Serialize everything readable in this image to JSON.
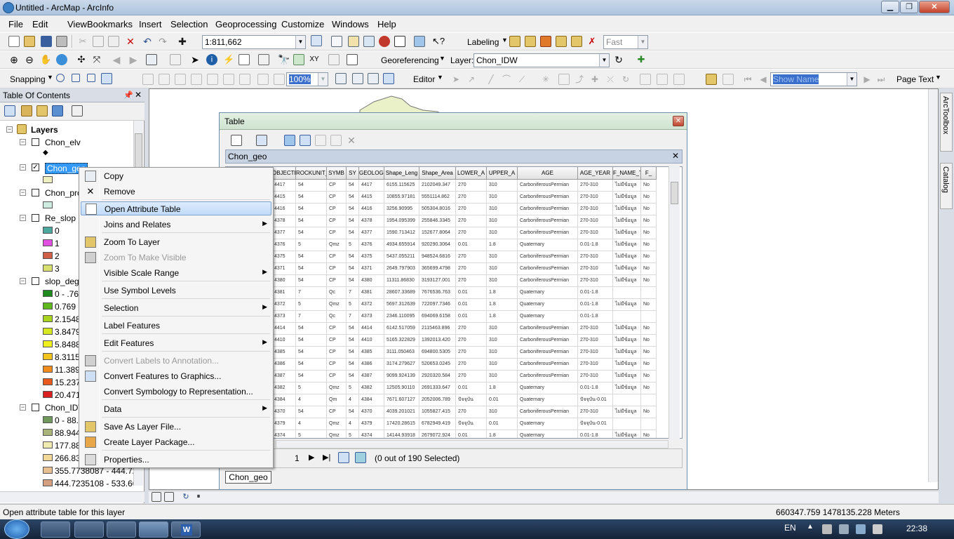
{
  "window": {
    "title": "Untitled - ArcMap - ArcInfo"
  },
  "menu": [
    "File",
    "Edit",
    "View",
    "Bookmarks",
    "Insert",
    "Selection",
    "Geoprocessing",
    "Customize",
    "Windows",
    "Help"
  ],
  "toolbar": {
    "scale": "1:811,662",
    "labeling": "Labeling",
    "fast": "Fast",
    "georeferencing": "Georeferencing",
    "layer_label": "Layer:",
    "layer_value": "Chon_IDW",
    "snapping": "Snapping",
    "zoom_pct": "100%",
    "editor": "Editor",
    "show_name": "Show Name",
    "page_text": "Page Text"
  },
  "toc": {
    "title": "Table Of Contents",
    "layers_root": "Layers",
    "items": [
      {
        "name": "Chon_elv"
      },
      {
        "name": "Chon_geo"
      },
      {
        "name": "Chon_pro"
      },
      {
        "name": "Re_slop"
      },
      {
        "name": "slop_deg"
      },
      {
        "name": "Chon_IDW"
      }
    ],
    "re_slop_classes": [
      "0",
      "1",
      "2",
      "3"
    ],
    "slop_classes": [
      "0 - .76",
      "0.769",
      "2.1548",
      "3.8479",
      "5.8488",
      "8.3115",
      "11.389",
      "15.237",
      "20.471"
    ],
    "idw_classes": [
      "0 - 88.9",
      "88.944",
      "177.88",
      "266.83",
      "355.7738087 - 444.72",
      "444.7235108 - 533.66"
    ]
  },
  "colors": {
    "re_slop": [
      "#4aa89c",
      "#e04fe0",
      "#d06048",
      "#d8e070"
    ],
    "slop": [
      "#1e8a1e",
      "#5fb81e",
      "#a8d41e",
      "#d8e81e",
      "#f0f01e",
      "#f4c41e",
      "#f08c1e",
      "#e85a1e",
      "#d8201e"
    ],
    "idw": [
      "#6f9a5c",
      "#a8b478",
      "#f0ecb0",
      "#f2d898",
      "#e8c090",
      "#d4a080"
    ]
  },
  "context_menu": [
    {
      "label": "Copy",
      "icon": "copy-icon"
    },
    {
      "label": "Remove",
      "icon": "remove-icon"
    },
    {
      "label": "Open Attribute Table",
      "icon": "table-icon",
      "highlight": true
    },
    {
      "label": "Joins and Relates",
      "submenu": true
    },
    {
      "label": "Zoom To Layer",
      "icon": "zoom-layer-icon"
    },
    {
      "label": "Zoom To Make Visible",
      "disabled": true,
      "icon": "zoom-visible-icon"
    },
    {
      "label": "Visible Scale Range",
      "submenu": true
    },
    {
      "label": "Use Symbol Levels"
    },
    {
      "label": "Selection",
      "submenu": true
    },
    {
      "label": "Label Features"
    },
    {
      "label": "Edit Features",
      "submenu": true
    },
    {
      "label": "Convert Labels to Annotation...",
      "disabled": true,
      "icon": "annotation-icon"
    },
    {
      "label": "Convert Features to Graphics...",
      "icon": "graphics-icon"
    },
    {
      "label": "Convert Symbology to Representation..."
    },
    {
      "label": "Data",
      "submenu": true
    },
    {
      "label": "Save As Layer File...",
      "icon": "layer-file-icon"
    },
    {
      "label": "Create Layer Package...",
      "icon": "package-icon"
    },
    {
      "label": "Properties...",
      "icon": "properties-icon"
    }
  ],
  "table_window": {
    "title": "Table",
    "tab": "Chon_geo",
    "bottom_tab": "Chon_geo",
    "record": "1",
    "selection_status": "(0 out of 190 Selected)",
    "columns": [
      "",
      "OBJECTI",
      "ROCKUNIT_ID",
      "SYMB",
      "SY",
      "GEOLOGY_",
      "Shape_Leng",
      "Shape_Area",
      "LOWER_A",
      "UPPER_A",
      "AGE",
      "AGE_YEAR",
      "F_NAME_T",
      "F_"
    ],
    "rows": [
      [
        "",
        "4417",
        "54",
        "CP",
        "54",
        "4417",
        "6155.115625",
        "2102049.347",
        "270",
        "310",
        "CarboniferousPermian",
        "270-310",
        "ไม่มีข้อมูล",
        "No"
      ],
      [
        "",
        "4415",
        "54",
        "CP",
        "54",
        "4415",
        "10855.97181",
        "5551114.862",
        "270",
        "310",
        "CarboniferousPermian",
        "270-310",
        "ไม่มีข้อมูล",
        "No"
      ],
      [
        "",
        "4416",
        "54",
        "CP",
        "54",
        "4416",
        "3256.90995",
        "505304.8016",
        "270",
        "310",
        "CarboniferousPermian",
        "270-310",
        "ไม่มีข้อมูล",
        "No"
      ],
      [
        "",
        "4378",
        "54",
        "CP",
        "54",
        "4378",
        "1954.095399",
        "255846.3345",
        "270",
        "310",
        "CarboniferousPermian",
        "270-310",
        "ไม่มีข้อมูล",
        "No"
      ],
      [
        "",
        "4377",
        "54",
        "CP",
        "54",
        "4377",
        "1590.713412",
        "152677.8064",
        "270",
        "310",
        "CarboniferousPermian",
        "270-310",
        "ไม่มีข้อมูล",
        "No"
      ],
      [
        "",
        "4376",
        "5",
        "Qmz",
        "5",
        "4376",
        "4934.655914",
        "920290.3064",
        "0.01",
        "1.8",
        "Quaternary",
        "0.01-1.8",
        "ไม่มีข้อมูล",
        "No"
      ],
      [
        "",
        "4375",
        "54",
        "CP",
        "54",
        "4375",
        "5437.055211",
        "948524.6816",
        "270",
        "310",
        "CarboniferousPermian",
        "270-310",
        "ไม่มีข้อมูล",
        "No"
      ],
      [
        "",
        "4371",
        "54",
        "CP",
        "54",
        "4371",
        "2649.797903",
        "365699.4798",
        "270",
        "310",
        "CarboniferousPermian",
        "270-310",
        "ไม่มีข้อมูล",
        "No"
      ],
      [
        "",
        "4380",
        "54",
        "CP",
        "54",
        "4380",
        "11311.86830",
        "3193127.001",
        "270",
        "310",
        "CarboniferousPermian",
        "270-310",
        "ไม่มีข้อมูล",
        "No"
      ],
      [
        "",
        "4381",
        "7",
        "Qc",
        "7",
        "4381",
        "28607.33689",
        "7676536.763",
        "0.01",
        "1.8",
        "Quaternary",
        "0.01-1.8",
        "",
        ""
      ],
      [
        "",
        "4372",
        "5",
        "Qmz",
        "5",
        "4372",
        "5697.312639",
        "722097.7346",
        "0.01",
        "1.8",
        "Quaternary",
        "0.01-1.8",
        "ไม่มีข้อมูล",
        "No"
      ],
      [
        "",
        "4373",
        "7",
        "Qc",
        "7",
        "4373",
        "2346.110095",
        "694069.6158",
        "0.01",
        "1.8",
        "Quaternary",
        "0.01-1.8",
        "",
        ""
      ],
      [
        "",
        "4414",
        "54",
        "CP",
        "54",
        "4414",
        "6142.517059",
        "2115463.896",
        "270",
        "310",
        "CarboniferousPermian",
        "270-310",
        "ไม่มีข้อมูล",
        "No"
      ],
      [
        "",
        "4410",
        "54",
        "CP",
        "54",
        "4410",
        "5165.322829",
        "1392013.420",
        "270",
        "310",
        "CarboniferousPermian",
        "270-310",
        "ไม่มีข้อมูล",
        "No"
      ],
      [
        "",
        "4385",
        "54",
        "CP",
        "54",
        "4385",
        "3111.050463",
        "694800.5305",
        "270",
        "310",
        "CarboniferousPermian",
        "270-310",
        "ไม่มีข้อมูล",
        "No"
      ],
      [
        "",
        "4386",
        "54",
        "CP",
        "54",
        "4386",
        "3174.279627",
        "520653.0245",
        "270",
        "310",
        "CarboniferousPermian",
        "270-310",
        "ไม่มีข้อมูล",
        "No"
      ],
      [
        "",
        "4387",
        "54",
        "CP",
        "54",
        "4387",
        "9099.924139",
        "2920320.584",
        "270",
        "310",
        "CarboniferousPermian",
        "270-310",
        "ไม่มีข้อมูล",
        "No"
      ],
      [
        "",
        "4382",
        "5",
        "Qmz",
        "5",
        "4382",
        "12505.90110",
        "2691333.647",
        "0.01",
        "1.8",
        "Quaternary",
        "0.01-1.8",
        "ไม่มีข้อมูล",
        "No"
      ],
      [
        "",
        "4384",
        "4",
        "Qm",
        "4",
        "4384",
        "7671.607127",
        "2052006.789",
        "ปัจจุบัน",
        "0.01",
        "Quaternary",
        "ปัจจุบัน-0.01",
        "",
        ""
      ],
      [
        "",
        "4370",
        "54",
        "CP",
        "54",
        "4370",
        "4039.201021",
        "1055827.415",
        "270",
        "310",
        "CarboniferousPermian",
        "270-310",
        "ไม่มีข้อมูล",
        "No"
      ],
      [
        "",
        "4379",
        "4",
        "Qmz",
        "4",
        "4379",
        "17420.28615",
        "6782949.419",
        "ปัจจุบัน",
        "0.01",
        "Quaternary",
        "ปัจจุบัน-0.01",
        "",
        ""
      ],
      [
        "",
        "4374",
        "5",
        "Qmz",
        "5",
        "4374",
        "14144.93918",
        "2679072.924",
        "0.01",
        "1.8",
        "Quaternary",
        "0.01-1.8",
        "ไม่มีข้อมูล",
        "No"
      ]
    ]
  },
  "side_tabs": [
    "ArcToolbox",
    "Catalog"
  ],
  "status": {
    "message": "Open attribute table for this layer",
    "coords": "660347.759  1478135.228 Meters"
  },
  "tray": {
    "lang": "EN",
    "time": "22:38"
  }
}
